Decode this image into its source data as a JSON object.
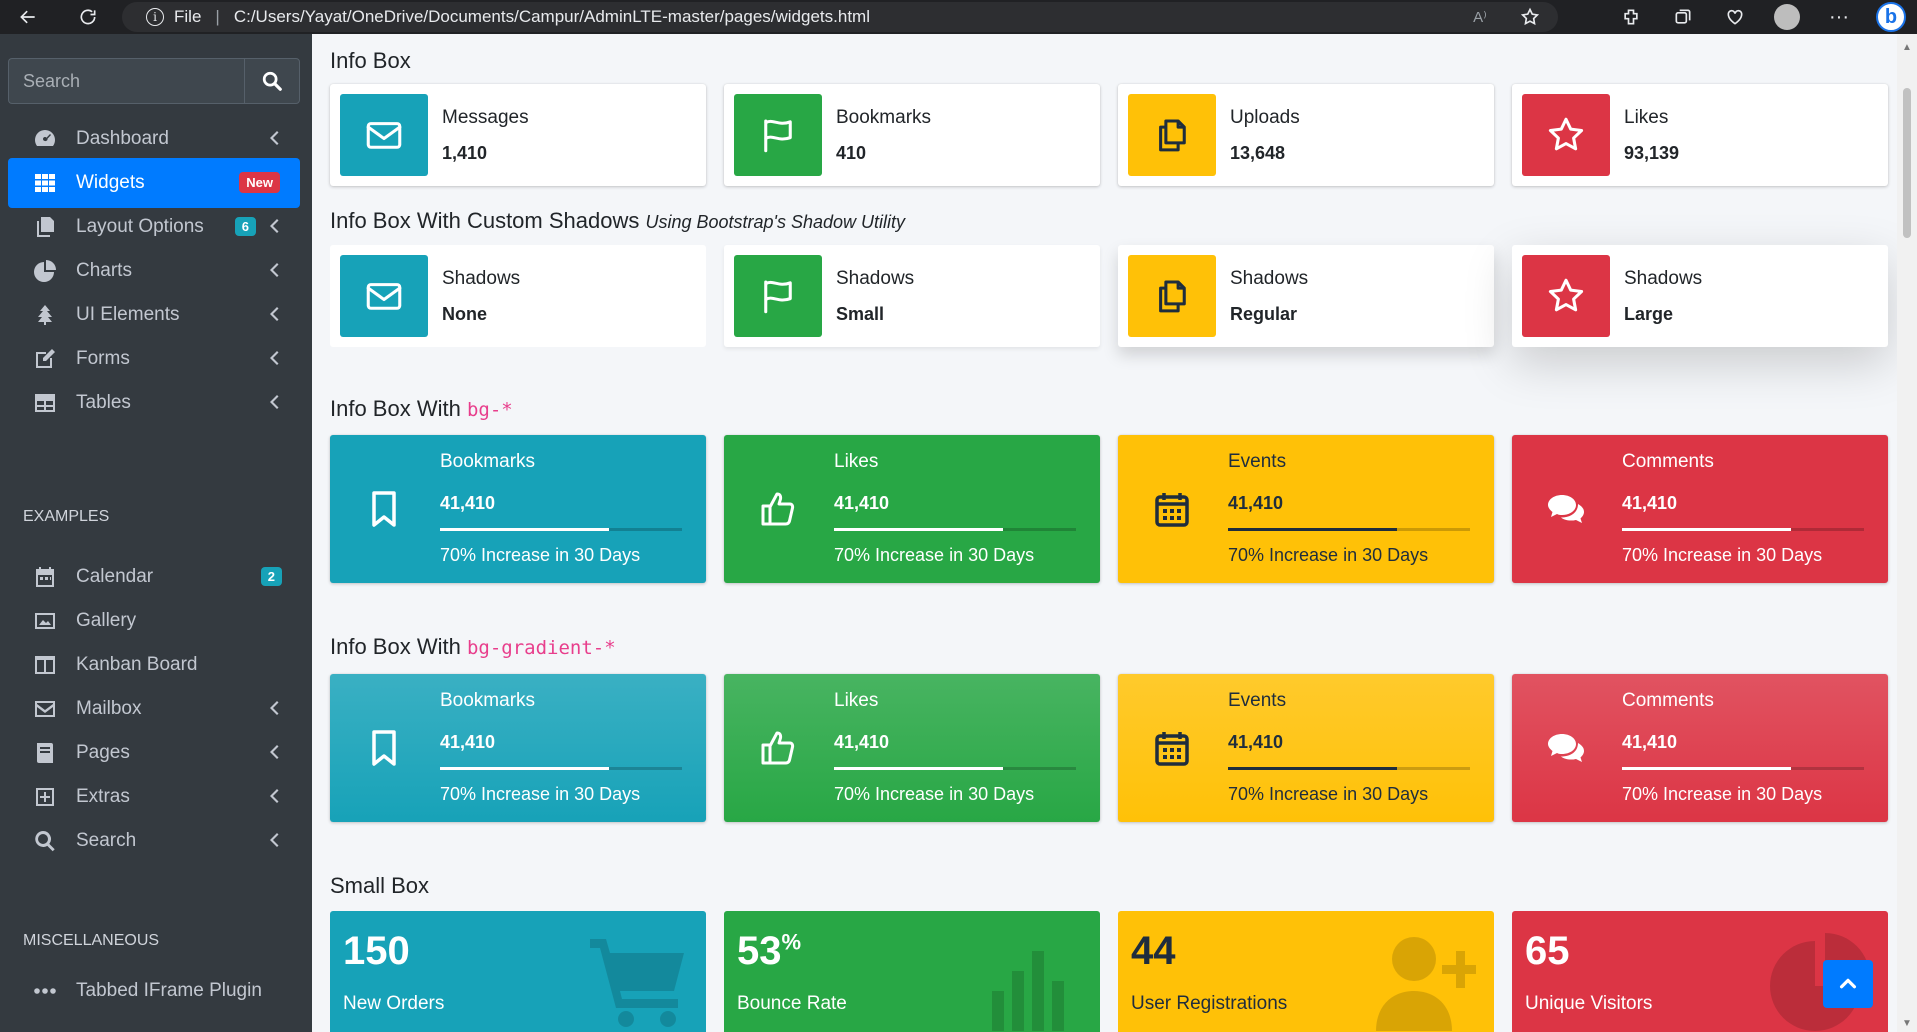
{
  "browser": {
    "file_label": "File",
    "address": "C:/Users/Yayat/OneDrive/Documents/Campur/AdminLTE-master/pages/widgets.html",
    "read_aloud_label": "A⁾"
  },
  "sidebar": {
    "search_placeholder": "Search",
    "items": [
      {
        "label": "Dashboard",
        "icon": "tachometer-icon",
        "chevron": true
      },
      {
        "label": "Widgets",
        "icon": "grid-icon",
        "badge": "New",
        "active": true
      },
      {
        "label": "Layout Options",
        "icon": "copy-icon",
        "badge": "6",
        "chevron": true
      },
      {
        "label": "Charts",
        "icon": "pie-chart-icon",
        "chevron": true
      },
      {
        "label": "UI Elements",
        "icon": "tree-icon",
        "chevron": true
      },
      {
        "label": "Forms",
        "icon": "edit-icon",
        "chevron": true
      },
      {
        "label": "Tables",
        "icon": "table-icon",
        "chevron": true
      }
    ],
    "examples_header": "EXAMPLES",
    "examples": [
      {
        "label": "Calendar",
        "icon": "calendar-icon",
        "badge": "2"
      },
      {
        "label": "Gallery",
        "icon": "image-icon"
      },
      {
        "label": "Kanban Board",
        "icon": "columns-icon"
      },
      {
        "label": "Mailbox",
        "icon": "envelope-icon",
        "chevron": true
      },
      {
        "label": "Pages",
        "icon": "book-icon",
        "chevron": true
      },
      {
        "label": "Extras",
        "icon": "plus-square-icon",
        "chevron": true
      },
      {
        "label": "Search",
        "icon": "search-icon",
        "chevron": true
      }
    ],
    "misc_header": "MISCELLANEOUS",
    "misc": [
      {
        "label": "Tabbed IFrame Plugin",
        "icon": "ellipsis-icon"
      }
    ]
  },
  "sections": {
    "info_box": "Info Box",
    "custom_shadows": "Info Box With Custom Shadows",
    "custom_shadows_small": "Using Bootstrap's Shadow Utility",
    "bg_title": "Info Box With ",
    "bg_code": "bg-*",
    "gradient_title": "Info Box With ",
    "gradient_code": "bg-gradient-*",
    "small_box": "Small Box"
  },
  "info_boxes": [
    {
      "text": "Messages",
      "number": "1,410",
      "color": "#17a2b8",
      "icon": "envelope-icon"
    },
    {
      "text": "Bookmarks",
      "number": "410",
      "color": "#28a745",
      "icon": "flag-icon"
    },
    {
      "text": "Uploads",
      "number": "13,648",
      "color": "#ffc107",
      "icon": "copy-icon"
    },
    {
      "text": "Likes",
      "number": "93,139",
      "color": "#dc3545",
      "icon": "star-icon"
    }
  ],
  "shadow_boxes": [
    {
      "text": "Shadows",
      "number": "None"
    },
    {
      "text": "Shadows",
      "number": "Small"
    },
    {
      "text": "Shadows",
      "number": "Regular"
    },
    {
      "text": "Shadows",
      "number": "Large"
    }
  ],
  "colored_boxes": [
    {
      "text": "Bookmarks",
      "number": "41,410",
      "desc": "70% Increase in 30 Days",
      "progress": 0.7,
      "icon": "bookmark-icon"
    },
    {
      "text": "Likes",
      "number": "41,410",
      "desc": "70% Increase in 30 Days",
      "progress": 0.7,
      "icon": "thumbs-up-icon"
    },
    {
      "text": "Events",
      "number": "41,410",
      "desc": "70% Increase in 30 Days",
      "progress": 0.7,
      "icon": "calendar-icon"
    },
    {
      "text": "Comments",
      "number": "41,410",
      "desc": "70% Increase in 30 Days",
      "progress": 0.7,
      "icon": "comments-icon"
    }
  ],
  "gradient_boxes": [
    {
      "text": "Bookmarks",
      "number": "41,410",
      "desc": "70% Increase in 30 Days",
      "progress": 0.7,
      "icon": "bookmark-icon"
    },
    {
      "text": "Likes",
      "number": "41,410",
      "desc": "70% Increase in 30 Days",
      "progress": 0.7,
      "icon": "thumbs-up-icon"
    },
    {
      "text": "Events",
      "number": "41,410",
      "desc": "70% Increase in 30 Days",
      "progress": 0.7,
      "icon": "calendar-icon"
    },
    {
      "text": "Comments",
      "number": "41,410",
      "desc": "70% Increase in 30 Days",
      "progress": 0.7,
      "icon": "comments-icon"
    }
  ],
  "small_boxes": [
    {
      "number": "150",
      "label": "New Orders",
      "icon": "shopping-cart-icon"
    },
    {
      "number": "53",
      "sup": "%",
      "label": "Bounce Rate",
      "icon": "bar-chart-icon"
    },
    {
      "number": "44",
      "label": "User Registrations",
      "icon": "user-plus-icon"
    },
    {
      "number": "65",
      "label": "Unique Visitors",
      "icon": "pie-chart-icon"
    }
  ],
  "colors": {
    "info": "#17a2b8",
    "success": "#28a745",
    "warning": "#ffc107",
    "danger": "#dc3545",
    "primary": "#007bff",
    "sidebar": "#343a40"
  }
}
